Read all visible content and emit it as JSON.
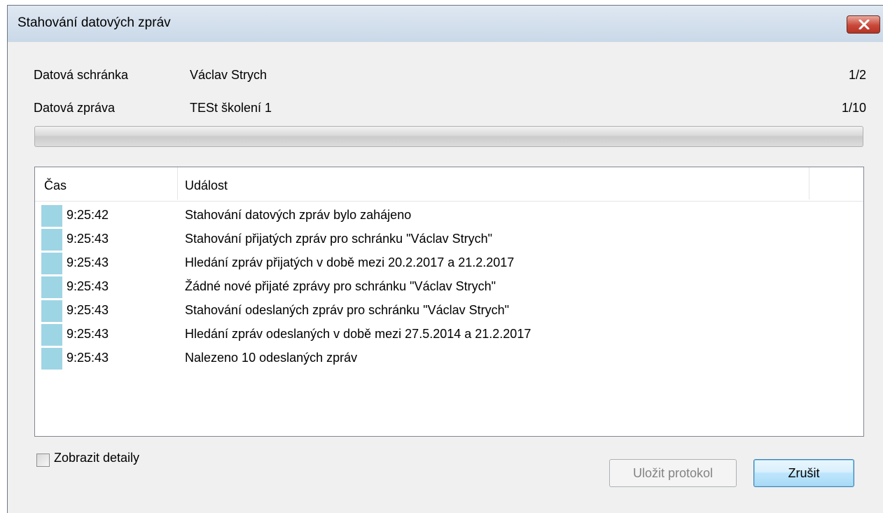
{
  "window": {
    "title": "Stahování datových zpráv",
    "close_icon": "close-icon"
  },
  "info": {
    "mailbox_label": "Datová schránka",
    "mailbox_value": "Václav Strych",
    "mailbox_count": "1/2",
    "message_label": "Datová zpráva",
    "message_value": "TESt školení 1",
    "message_count": "1/10"
  },
  "progress": {
    "percent": 0
  },
  "log": {
    "columns": [
      "Čas",
      "Událost"
    ],
    "rows": [
      {
        "time": "9:25:42",
        "event": "Stahování datových zpráv bylo zahájeno"
      },
      {
        "time": "9:25:43",
        "event": "Stahování přijatých zpráv pro schránku \"Václav Strych\""
      },
      {
        "time": "9:25:43",
        "event": "Hledání zpráv přijatých v době mezi 20.2.2017 a 21.2.2017"
      },
      {
        "time": "9:25:43",
        "event": "Žádné nové přijaté zprávy pro schránku \"Václav Strych\""
      },
      {
        "time": "9:25:43",
        "event": "Stahování odeslaných zpráv pro schránku \"Václav Strych\""
      },
      {
        "time": "9:25:43",
        "event": "Hledání zpráv odeslaných v době mezi 27.5.2014 a 21.2.2017"
      },
      {
        "time": "9:25:43",
        "event": "Nalezeno 10 odeslaných zpráv"
      }
    ],
    "row_icon_color": "#9ed5e4"
  },
  "footer": {
    "show_details_label": "Zobrazit detaily",
    "show_details_checked": false,
    "save_log_label": "Uložit protokol",
    "save_log_enabled": false,
    "cancel_label": "Zrušit"
  }
}
